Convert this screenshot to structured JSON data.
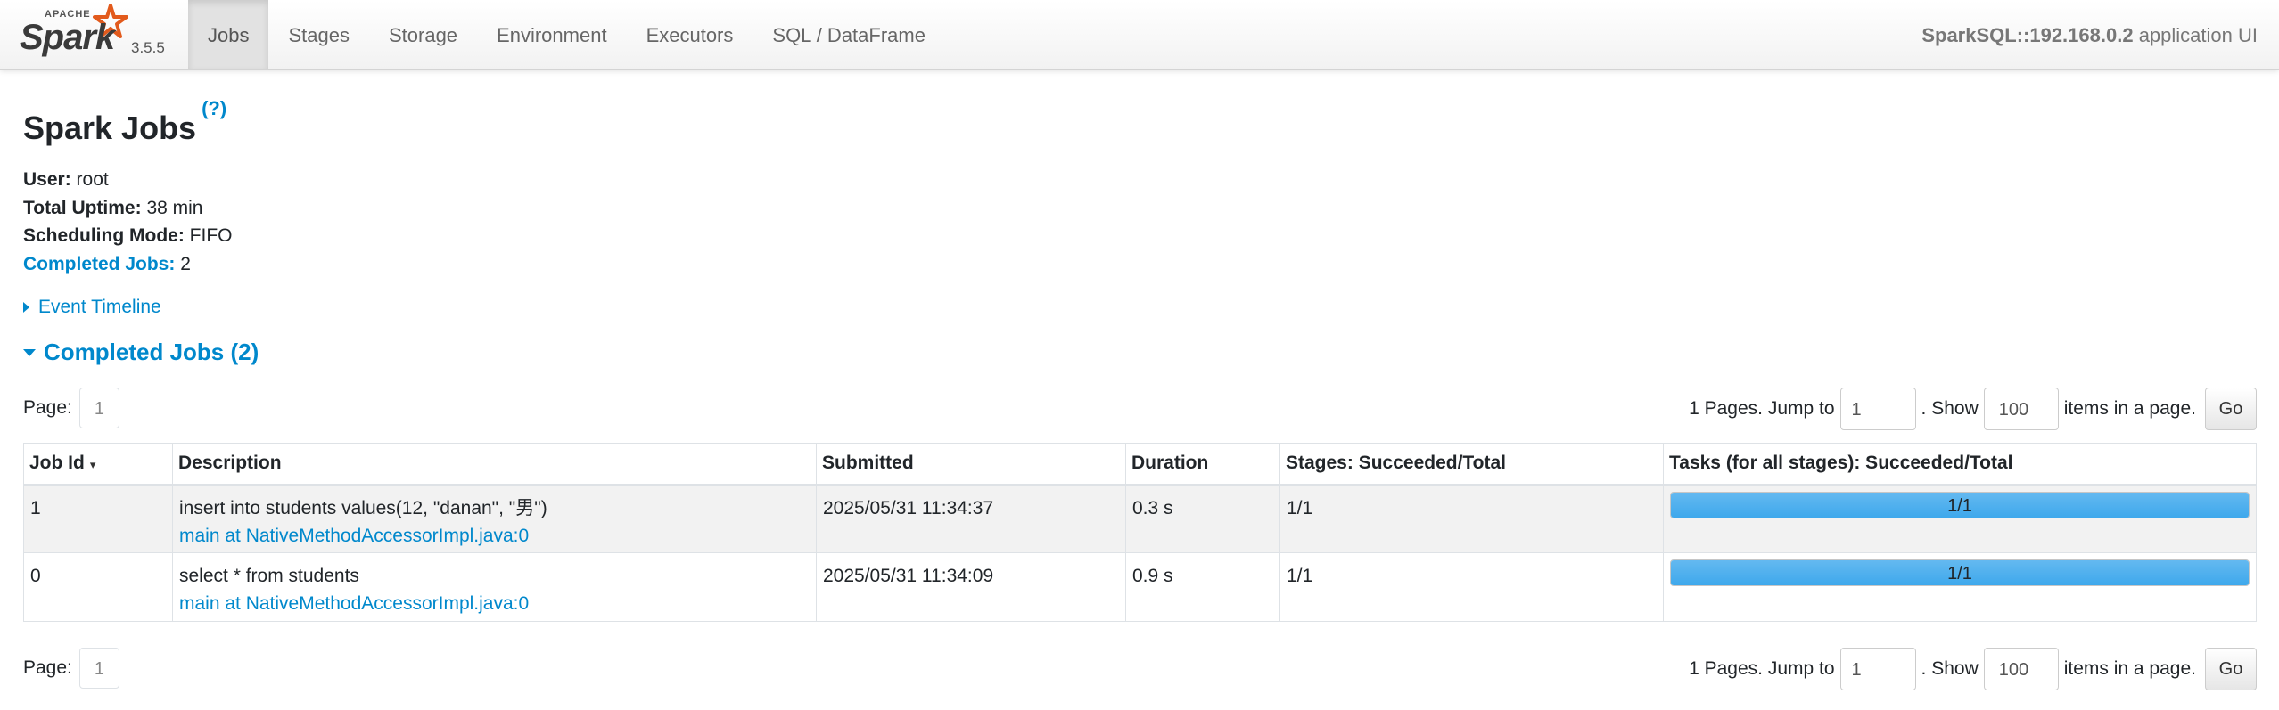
{
  "brand": {
    "apache": "APACHE",
    "name": "Spark",
    "version": "3.5.5",
    "star_color": "#e25a1c"
  },
  "nav": {
    "tabs": [
      {
        "label": "Jobs",
        "active": true
      },
      {
        "label": "Stages"
      },
      {
        "label": "Storage"
      },
      {
        "label": "Environment"
      },
      {
        "label": "Executors"
      },
      {
        "label": "SQL / DataFrame"
      }
    ],
    "app_name": "SparkSQL::192.168.0.2",
    "app_suffix": " application UI"
  },
  "page": {
    "title": "Spark Jobs",
    "help": "(?)"
  },
  "summary": {
    "user_label": "User:",
    "user_value": " root",
    "uptime_label": "Total Uptime:",
    "uptime_value": " 38 min",
    "sched_label": "Scheduling Mode:",
    "sched_value": " FIFO",
    "completed_label": "Completed Jobs:",
    "completed_value": " 2"
  },
  "timeline": {
    "label": "Event Timeline"
  },
  "section": {
    "label": "Completed Jobs (2)"
  },
  "pager": {
    "page_label": "Page:",
    "page_current": "1",
    "pages_text": "1 Pages. Jump to",
    "jump_value": "1",
    "show_text": ". Show",
    "show_value": "100",
    "items_text": "items in a page.",
    "go_label": "Go"
  },
  "table": {
    "headers": [
      "Job Id",
      "Description",
      "Submitted",
      "Duration",
      "Stages: Succeeded/Total",
      "Tasks (for all stages): Succeeded/Total"
    ],
    "sort_indicator": "▾",
    "rows": [
      {
        "job_id": "1",
        "description": "insert into students values(12, \"danan\", \"男\")",
        "callsite": "main at NativeMethodAccessorImpl.java:0",
        "submitted": "2025/05/31 11:34:37",
        "duration": "0.3 s",
        "stages": "1/1",
        "tasks": "1/1",
        "tasks_fraction": 1.0
      },
      {
        "job_id": "0",
        "description": "select * from students",
        "callsite": "main at NativeMethodAccessorImpl.java:0",
        "submitted": "2025/05/31 11:34:09",
        "duration": "0.9 s",
        "stages": "1/1",
        "tasks": "1/1",
        "tasks_fraction": 1.0
      }
    ]
  }
}
